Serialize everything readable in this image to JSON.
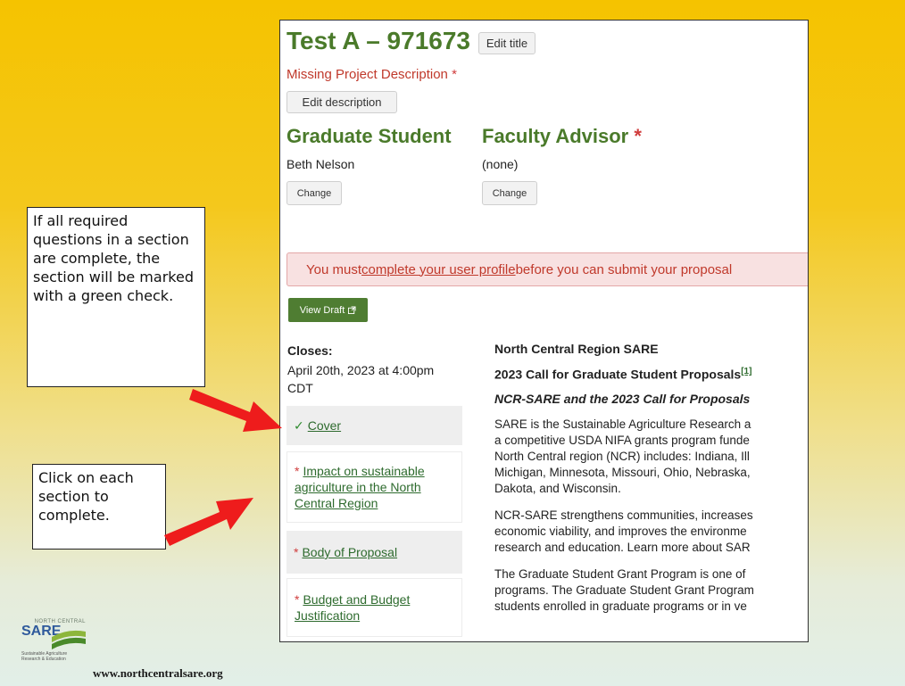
{
  "project": {
    "title": "Test A – 971673",
    "edit_title_label": "Edit title",
    "missing_description": "Missing Project Description",
    "required_star": "*",
    "edit_description_label": "Edit description"
  },
  "people": {
    "graduate_student": {
      "heading": "Graduate Student",
      "name": "Beth Nelson",
      "change_label": "Change"
    },
    "faculty_advisor": {
      "heading": "Faculty Advisor",
      "name": "(none)",
      "change_label": "Change"
    }
  },
  "alert": {
    "prefix": "You must ",
    "link": "complete your user profile",
    "suffix": " before you can submit your proposal"
  },
  "view_draft": {
    "label": "View Draft",
    "icon": "external-link-icon"
  },
  "closes": {
    "label": "Closes:",
    "date": "April 20th, 2023 at 4:00pm CDT"
  },
  "sections": [
    {
      "marker": "✓",
      "label": "Cover",
      "complete": true
    },
    {
      "marker": "*",
      "label": "Impact on sustainable agriculture in the North Central Region",
      "complete": false
    },
    {
      "marker": "*",
      "label": "Body of Proposal",
      "complete": false
    },
    {
      "marker": "*",
      "label": "Budget and Budget Justification",
      "complete": false
    }
  ],
  "description": {
    "region_title": "North Central Region SARE",
    "call_title": "2023 Call for Graduate Student Proposals",
    "footnote": "[1]",
    "subheading": "NCR-SARE and the 2023 Call for Proposals",
    "para1": [
      "SARE is the Sustainable Agriculture Research a",
      "a competitive USDA NIFA grants program funde",
      "North Central region (NCR) includes: Indiana, Ill",
      "Michigan, Minnesota, Missouri, Ohio, Nebraska,",
      "Dakota, and Wisconsin."
    ],
    "para2": [
      "NCR-SARE strengthens communities, increases",
      "economic viability, and improves the environme",
      "research and education. Learn more about SAR"
    ],
    "para3": [
      "The Graduate Student Grant Program is one of",
      "programs. The Graduate Student Grant Program",
      "students enrolled in graduate programs or in ve"
    ]
  },
  "callouts": {
    "check_tip": "If all required questions in a section are complete, the section will be marked with a green check.",
    "click_tip": "Click on each section to complete."
  },
  "logo": {
    "top": "NORTH CENTRAL",
    "main": "SARE",
    "sub1": "Sustainable Agriculture",
    "sub2": "Research & Education"
  },
  "footer": {
    "url": "www.northcentralsare.org"
  },
  "colors": {
    "brand_green": "#4a7a2a",
    "required_red": "#d03c3c",
    "arrow_red": "#ee1c1c",
    "draft_button": "#4f7d32"
  }
}
